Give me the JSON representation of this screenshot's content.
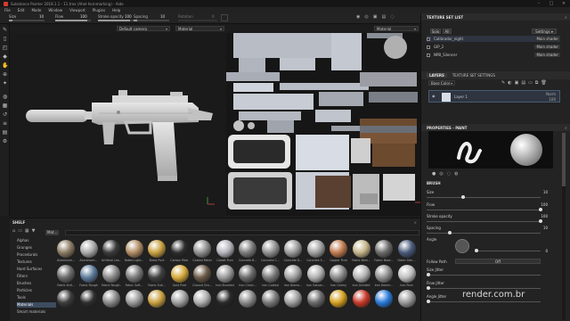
{
  "app": {
    "title": "Substance Painter 2018.1.1 - 11.trex (Ahel-hornmarking) - Aide"
  },
  "menu": [
    "File",
    "Edit",
    "Mode",
    "Window",
    "Viewport",
    "Plugins",
    "Help"
  ],
  "toolbar": {
    "size_label": "Size",
    "size_value": "10",
    "flow_label": "Flow",
    "flow_value": "100",
    "stroke_opacity_label": "Stroke opacity",
    "stroke_opacity_value": "100",
    "spacing_label": "Spacing",
    "spacing_value": "10",
    "rotation_label": "Rotation",
    "rotation_value": "0",
    "flow_fill": 0.9,
    "opacity_fill": 0.9
  },
  "viewport3d": {
    "camera_select": "Default camera"
  },
  "viewport2d": {
    "channel_select_left": "Material",
    "channel_select_right": "Material"
  },
  "shelf": {
    "title": "SHELF",
    "search_tag": "Mat...",
    "categories": [
      "Alphas",
      "Grunges",
      "Procedurals",
      "Textures",
      "Hard Surfaces",
      "Filters",
      "Brushes",
      "Particles",
      "Tools",
      "Materials",
      "Smart materials"
    ],
    "selected_category": "Materials",
    "row1": [
      {
        "label": "Aluminium...",
        "color": "#8a7a62"
      },
      {
        "label": "Aluminium...",
        "color": "#a9a9a9"
      },
      {
        "label": "Artificial Lea...",
        "color": "#3a3a3a"
      },
      {
        "label": "Baked Light...",
        "color": "#b08c64"
      },
      {
        "label": "Brass Pure",
        "color": "#c8a040"
      },
      {
        "label": "Carbon Fiber",
        "color": "#2d2d2d"
      },
      {
        "label": "Coated Metal",
        "color": "#8f8f8f"
      },
      {
        "label": "Cobalt Pure",
        "color": "#b4b4bc"
      },
      {
        "label": "Concrete B...",
        "color": "#7a7a7a"
      },
      {
        "label": "Concrete C...",
        "color": "#909090"
      },
      {
        "label": "Concrete D...",
        "color": "#9a9a9a"
      },
      {
        "label": "Concrete S...",
        "color": "#a0a0a0"
      },
      {
        "label": "Copper Pure",
        "color": "#c07a50"
      },
      {
        "label": "Fabric Bam...",
        "color": "#c4b48a"
      },
      {
        "label": "Fabric Base...",
        "color": "#6a6a6a"
      },
      {
        "label": "Fabric Den...",
        "color": "#4a5a7a"
      }
    ],
    "row2": [
      {
        "label": "Fabric Knit...",
        "color": "#6a6a6a"
      },
      {
        "label": "Fabric Rough",
        "color": "#5d7a9a"
      },
      {
        "label": "Fabric Rough...",
        "color": "#8a8a8a"
      },
      {
        "label": "Fabric Soft...",
        "color": "#7a7a7a"
      },
      {
        "label": "Fabric Suit...",
        "color": "#404040"
      },
      {
        "label": "Gold Pure",
        "color": "#d4a83a"
      },
      {
        "label": "Ground Gra...",
        "color": "#6a5a48"
      },
      {
        "label": "Iron Brushed",
        "color": "#9a9a9a"
      },
      {
        "label": "Iron Chain...",
        "color": "#6a6a6a"
      },
      {
        "label": "Iron Coated",
        "color": "#7a7a7a"
      },
      {
        "label": "Iron Diamo...",
        "color": "#a0a0a0"
      },
      {
        "label": "Iron Galvan...",
        "color": "#b0b0b0"
      },
      {
        "label": "Iron Grainy",
        "color": "#8a8a8a"
      },
      {
        "label": "Iron Grinded",
        "color": "#b4b4b4"
      },
      {
        "label": "Iron Hamm...",
        "color": "#909090"
      },
      {
        "label": "Iron Pure",
        "color": "#c0c0c0"
      }
    ],
    "row3": [
      {
        "label": "",
        "color": "#3c3c3c"
      },
      {
        "label": "",
        "color": "#2e2e2e"
      },
      {
        "label": "",
        "color": "#8a8a8a"
      },
      {
        "label": "",
        "color": "#9a9a9a"
      },
      {
        "label": "",
        "color": "#c8a040"
      },
      {
        "label": "",
        "color": "#a0a0a0"
      },
      {
        "label": "",
        "color": "#b0b0b0"
      },
      {
        "label": "",
        "color": "#2a2a2a"
      },
      {
        "label": "",
        "color": "#8a8a8a"
      },
      {
        "label": "",
        "color": "#7a7a7a"
      },
      {
        "label": "",
        "color": "#a0a0a0"
      },
      {
        "label": "",
        "color": "#6a6a6a"
      },
      {
        "label": "",
        "color": "#d4a020"
      },
      {
        "label": "",
        "color": "#c83a2a"
      },
      {
        "label": "",
        "color": "#2a7ad8"
      },
      {
        "label": "",
        "color": "#9a9a9a"
      }
    ]
  },
  "texture_set_list": {
    "title": "TEXTURE SET LIST",
    "btn_solo": "Solo",
    "btn_all": "All",
    "settings_select": "Settings",
    "items": [
      {
        "name": "Calibrador_night",
        "shader": "Main shader"
      },
      {
        "name": "GIP_2",
        "shader": "Main shader"
      },
      {
        "name": "NPB_Silencer",
        "shader": "Main shader"
      }
    ]
  },
  "layers": {
    "tab_layers": "LAYERS",
    "tab_settings": "TEXTURE SET SETTINGS",
    "channel_select": "Base Color",
    "layer_name": "Layer 1",
    "blend_mode": "Norm",
    "opacity": "100"
  },
  "properties": {
    "title": "PROPERTIES - PAINT",
    "section_brush": "BRUSH",
    "size_label": "Size",
    "size_value": "10",
    "flow_label": "Flow",
    "flow_value": "100",
    "stroke_opacity_label": "Stroke opacity",
    "stroke_opacity_value": "100",
    "spacing_label": "Spacing",
    "spacing_value": "10",
    "angle_label": "Angle",
    "angle_value": "0",
    "follow_path_label": "Follow Path",
    "follow_path_value": "Off",
    "size_jitter_label": "Size Jitter",
    "flow_jitter_label": "Flow Jitter",
    "angle_jitter_label": "Angle Jitter"
  },
  "watermark": "render.com.br",
  "icons": [
    "gun-model",
    "tool-icons"
  ]
}
